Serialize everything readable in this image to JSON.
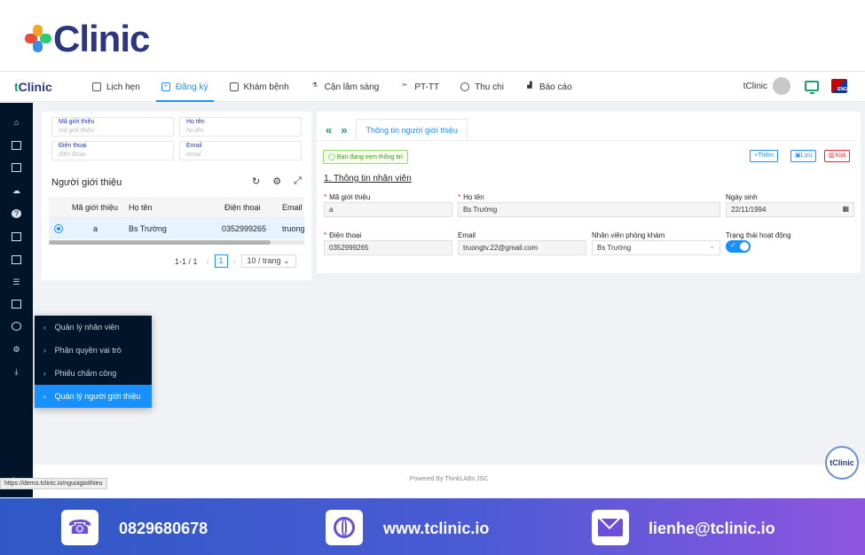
{
  "banner": {
    "brand": "Clinic"
  },
  "topnav": {
    "brand_t": "t",
    "brand": "Clinic",
    "items": [
      {
        "label": "Lịch hẹn",
        "icon": "calendar-icon"
      },
      {
        "label": "Đăng ký",
        "icon": "register-icon"
      },
      {
        "label": "Khám bệnh",
        "icon": "exam-icon"
      },
      {
        "label": "Cận lâm sàng",
        "icon": "lab-icon"
      },
      {
        "label": "PT-TT",
        "icon": "scissors-icon"
      },
      {
        "label": "Thu chi",
        "icon": "money-icon"
      },
      {
        "label": "Báo cáo",
        "icon": "chart-icon"
      }
    ],
    "user": "tClinic",
    "lang": "ENG"
  },
  "submenu": [
    "Quản lý nhân viên",
    "Phân quyền vai trò",
    "Phiếu chấm công",
    "Quản lý người giới thiệu"
  ],
  "filter": {
    "code_label": "Mã giới thiệu",
    "code_ph": "mã giới thiệu",
    "name_label": "Họ tên",
    "name_ph": "họ tên",
    "phone_label": "Điện thoại",
    "phone_ph": "điện thoại",
    "email_label": "Email",
    "email_ph": "email"
  },
  "list": {
    "title": "Người giới thiệu",
    "columns": [
      "Mã giới thiệu",
      "Họ tên",
      "Điện thoại",
      "Email"
    ],
    "rows": [
      {
        "code": "a",
        "name": "Bs Trường",
        "phone": "0352999265",
        "email": "truong"
      }
    ],
    "range": "1-1 / 1",
    "page": "1",
    "page_size": "10 / trang"
  },
  "detail": {
    "tab": "Thông tin người giới thiệu",
    "viewing": "Bạn đang xem thông tin",
    "btn_add": "Thêm",
    "btn_save": "Lưu",
    "btn_delete": "Xoá",
    "section": "1. Thông tin nhân viên",
    "fields": {
      "code_label": "Mã giới thiệu",
      "code": "a",
      "name_label": "Họ tên",
      "name": "Bs Trường",
      "dob_label": "Ngày sinh",
      "dob": "22/11/1994",
      "phone_label": "Điện thoại",
      "phone": "0352999265",
      "email_label": "Email",
      "email": "truongtv.22@gmail.com",
      "staff_label": "Nhân viên phòng khám",
      "staff": "Bs Trường",
      "status_label": "Trạng thái hoạt động"
    }
  },
  "footer": "Powered By ThinkLABs JSC",
  "float_badge": "tClinic",
  "url_tip": "https://demo.tclinic.io/nguoigioithieu",
  "contact": {
    "phone": "0829680678",
    "web": "www.tclinic.io",
    "email": "lienhe@tclinic.io"
  },
  "colors": {
    "brand": "#2b3580",
    "accent": "#1890ff",
    "green": "#19a463",
    "sidebar": "#001529"
  }
}
